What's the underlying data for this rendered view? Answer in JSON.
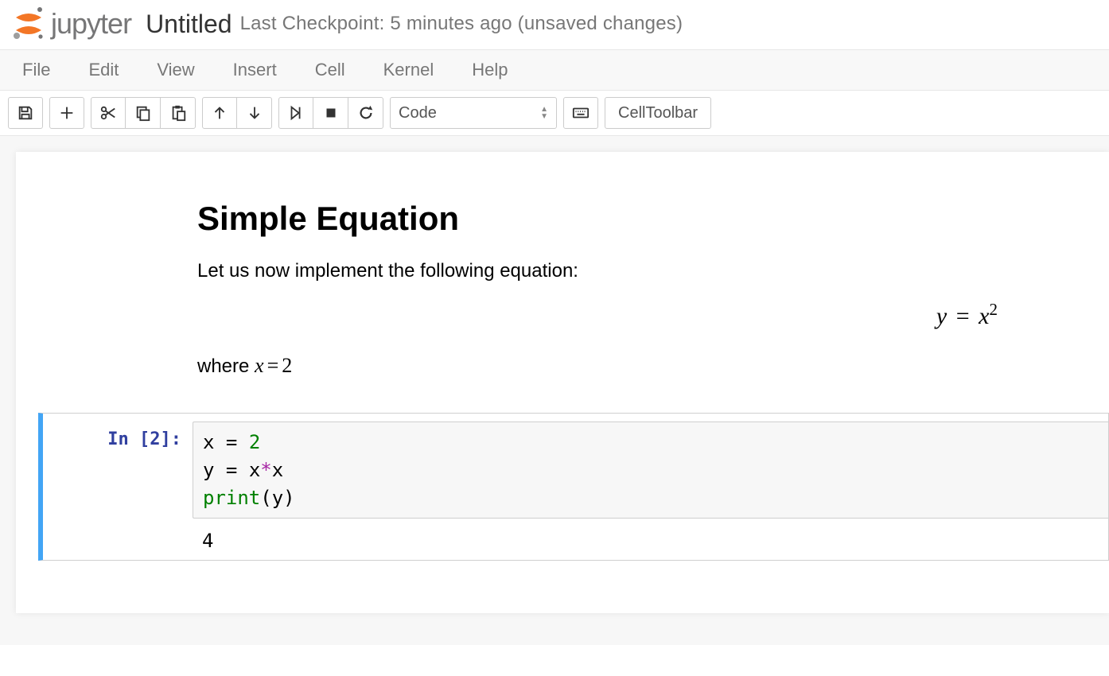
{
  "header": {
    "logo_word": "jupyter",
    "notebook_name": "Untitled",
    "checkpoint_text": "Last Checkpoint: 5 minutes ago (unsaved changes)"
  },
  "menubar": {
    "items": [
      "File",
      "Edit",
      "View",
      "Insert",
      "Cell",
      "Kernel",
      "Help"
    ]
  },
  "toolbar": {
    "cell_type_selected": "Code",
    "celltoolbar_label": "CellToolbar"
  },
  "cells": {
    "markdown": {
      "heading": "Simple Equation",
      "intro": "Let us now implement the following equation:",
      "equation_lhs": "y",
      "equation_rhs_base": "x",
      "equation_rhs_exp": "2",
      "where_prefix": "where ",
      "where_var": "x",
      "where_val": "2"
    },
    "code": {
      "prompt": "In [2]:",
      "line1": {
        "var": "x",
        "assign": " = ",
        "val": "2"
      },
      "line2": {
        "var": "y",
        "assign": " = ",
        "a": "x",
        "op": "*",
        "b": "x"
      },
      "line3": {
        "fn": "print",
        "open": "(",
        "arg": "y",
        "close": ")"
      },
      "output": "4"
    }
  }
}
